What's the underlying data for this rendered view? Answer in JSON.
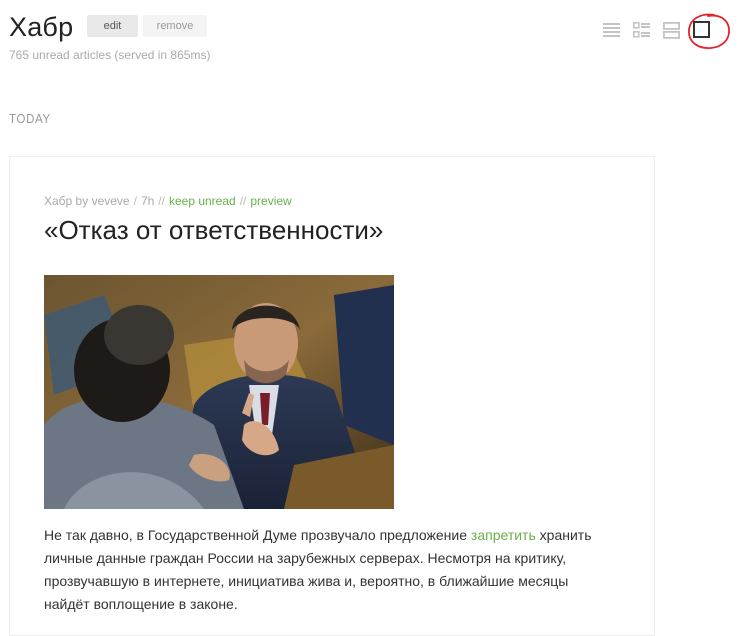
{
  "feed": {
    "title": "Хабр",
    "edit_label": "edit",
    "remove_label": "remove",
    "subtitle": "765 unread articles (served in 865ms)"
  },
  "view_modes": [
    {
      "icon": "list-view-icon"
    },
    {
      "icon": "detail-list-view-icon"
    },
    {
      "icon": "card-view-icon"
    },
    {
      "icon": "full-view-icon",
      "highlighted": true
    }
  ],
  "annotation_color": "#e8202a",
  "section": {
    "title": "TODAY"
  },
  "article": {
    "source": "Хабр by veveve",
    "age": "7h",
    "keep_unread": "keep unread",
    "preview": "preview",
    "title": "«Отказ от ответственности»",
    "image_alt": "Photo of men in suits in a parliament hall",
    "body_before_link": "Не так давно, в Государственной Думе прозвучало предложение ",
    "body_link": "запретить",
    "body_after_link": " хранить личные данные граждан России на зарубежных серверах. Несмотря на критику, прозвучавшую в интернете, инициатива жива и, вероятно, в ближайшие месяцы найдёт воплощение в законе."
  },
  "colors": {
    "accent_link": "#6ab04c",
    "muted_text": "#aaaaaa"
  }
}
